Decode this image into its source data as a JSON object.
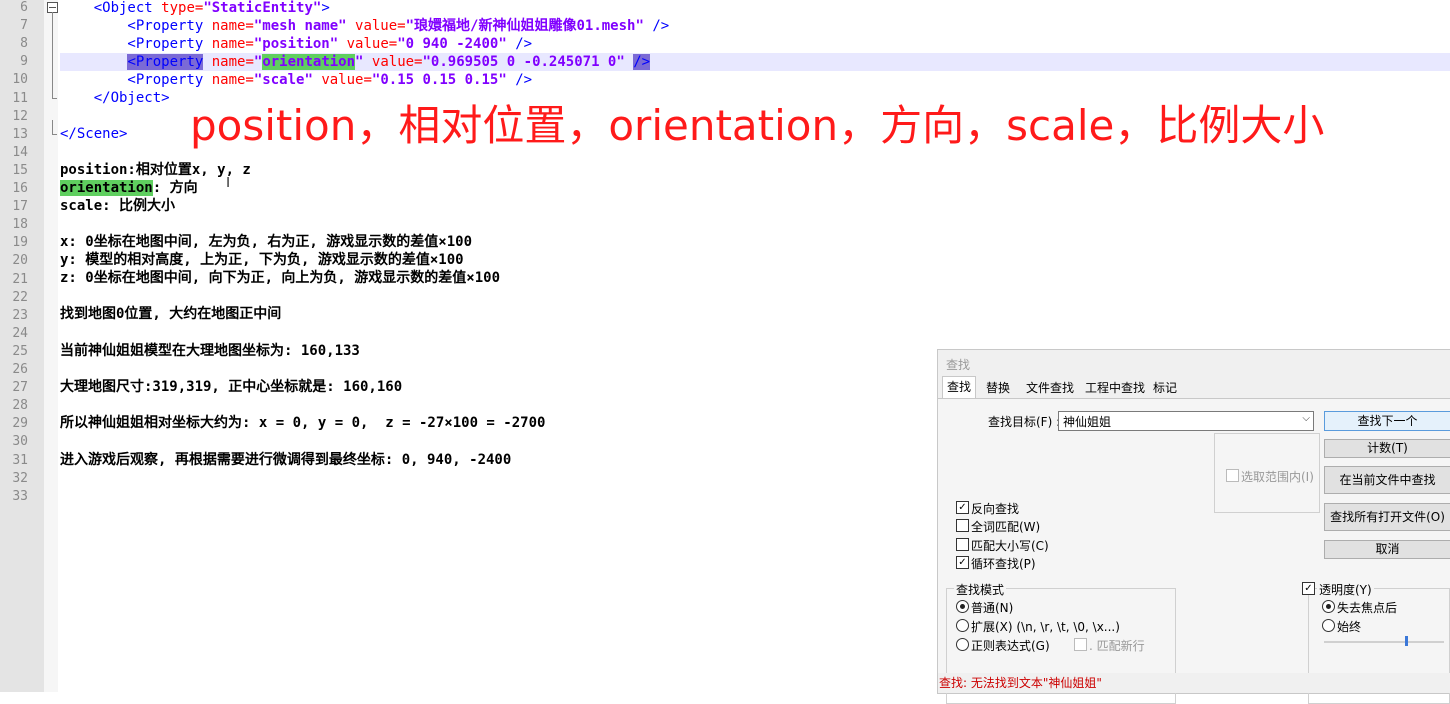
{
  "line_numbers": [
    "6",
    "7",
    "8",
    "9",
    "10",
    "11",
    "12",
    "13",
    "14",
    "15",
    "16",
    "17",
    "18",
    "19",
    "20",
    "21",
    "22",
    "23",
    "24",
    "25",
    "26",
    "27",
    "28",
    "29",
    "30",
    "31",
    "32",
    "33"
  ],
  "code": {
    "l6": "    <Object type=\"StaticEntity\">",
    "l6_tag1": "    <Object ",
    "l6_attr": "type=",
    "l6_val": "\"StaticEntity\"",
    "l6_tag2": ">",
    "l7_tag1": "        <Property ",
    "l7_a1": "name=",
    "l7_v1": "\"mesh name\"",
    "l7_a2": " value=",
    "l7_v2": "\"琅嬛福地/新神仙姐姐雕像01.mesh\"",
    "l7_tag2": " />",
    "l8_tag1": "        <Property ",
    "l8_a1": "name=",
    "l8_v1": "\"position\"",
    "l8_a2": " value=",
    "l8_v2": "\"0 940 -2400\"",
    "l8_tag2": " />",
    "l9_pre": "        ",
    "l9_tag1": "<Property",
    "l9_sp": " ",
    "l9_a1": "name=",
    "l9_q1": "\"",
    "l9_v1": "orientation",
    "l9_q2": "\"",
    "l9_a2": " value=",
    "l9_v2": "\"0.969505 0 -0.245071 0\"",
    "l9_sp2": " ",
    "l9_tag2": "/>",
    "l10_tag1": "        <Property ",
    "l10_a1": "name=",
    "l10_v1": "\"scale\"",
    "l10_a2": " value=",
    "l10_v2": "\"0.15 0.15 0.15\"",
    "l10_tag2": " />",
    "l11": "    </Object>",
    "l13": "</Scene>",
    "l15": "position:相对位置x, y, z",
    "l16_a": "orientation",
    "l16_b": ": 方向",
    "l17": "scale: 比例大小",
    "l19": "x: 0坐标在地图中间, 左为负, 右为正, 游戏显示数的差值×100",
    "l20": "y: 模型的相对高度, 上为正, 下为负, 游戏显示数的差值×100",
    "l21": "z: 0坐标在地图中间, 向下为正, 向上为负, 游戏显示数的差值×100",
    "l23": "找到地图0位置, 大约在地图正中间",
    "l25": "当前神仙姐姐模型在大理地图坐标为: 160,133",
    "l27": "大理地图尺寸:319,319, 正中心坐标就是: 160,160",
    "l29": "所以神仙姐姐相对坐标大约为: x = 0, y = 0,  z = -27×100 = -2700",
    "l31": "进入游戏后观察, 再根据需要进行微调得到最终坐标: 0, 940, -2400"
  },
  "overlay_caption": "position，相对位置，orientation，方向，scale，比例大小",
  "find_dialog": {
    "title": "查找",
    "tabs": [
      "查找",
      "替换",
      "文件查找",
      "工程中查找",
      "标记"
    ],
    "target_label": "查找目标(F) :",
    "target_value": "神仙姐姐",
    "buttons": {
      "find_next": "查找下一个",
      "count": "计数(T)",
      "find_in_current": "在当前文件中查找",
      "find_in_all": "查找所有打开文件(O)",
      "cancel": "取消"
    },
    "in_selection": "选取范围内(I)",
    "options": [
      {
        "label": "反向查找",
        "checked": true
      },
      {
        "label": "全词匹配(W)",
        "checked": false
      },
      {
        "label": "匹配大小写(C)",
        "checked": false
      },
      {
        "label": "循环查找(P)",
        "checked": true
      }
    ],
    "search_mode_label": "查找模式",
    "modes": [
      {
        "label": "普通(N)",
        "selected": true
      },
      {
        "label": "扩展(X) (\\n, \\r, \\t, \\0, \\x...)",
        "selected": false
      },
      {
        "label": "正则表达式(G)",
        "selected": false
      }
    ],
    "match_newline": ". 匹配新行",
    "transparency_label": "透明度(Y)",
    "transparency_checked": true,
    "transparency_modes": [
      {
        "label": "失去焦点后",
        "selected": true
      },
      {
        "label": "始终",
        "selected": false
      }
    ],
    "transparency_level": 0.68,
    "status": "查找: 无法找到文本\"神仙姐姐\""
  }
}
